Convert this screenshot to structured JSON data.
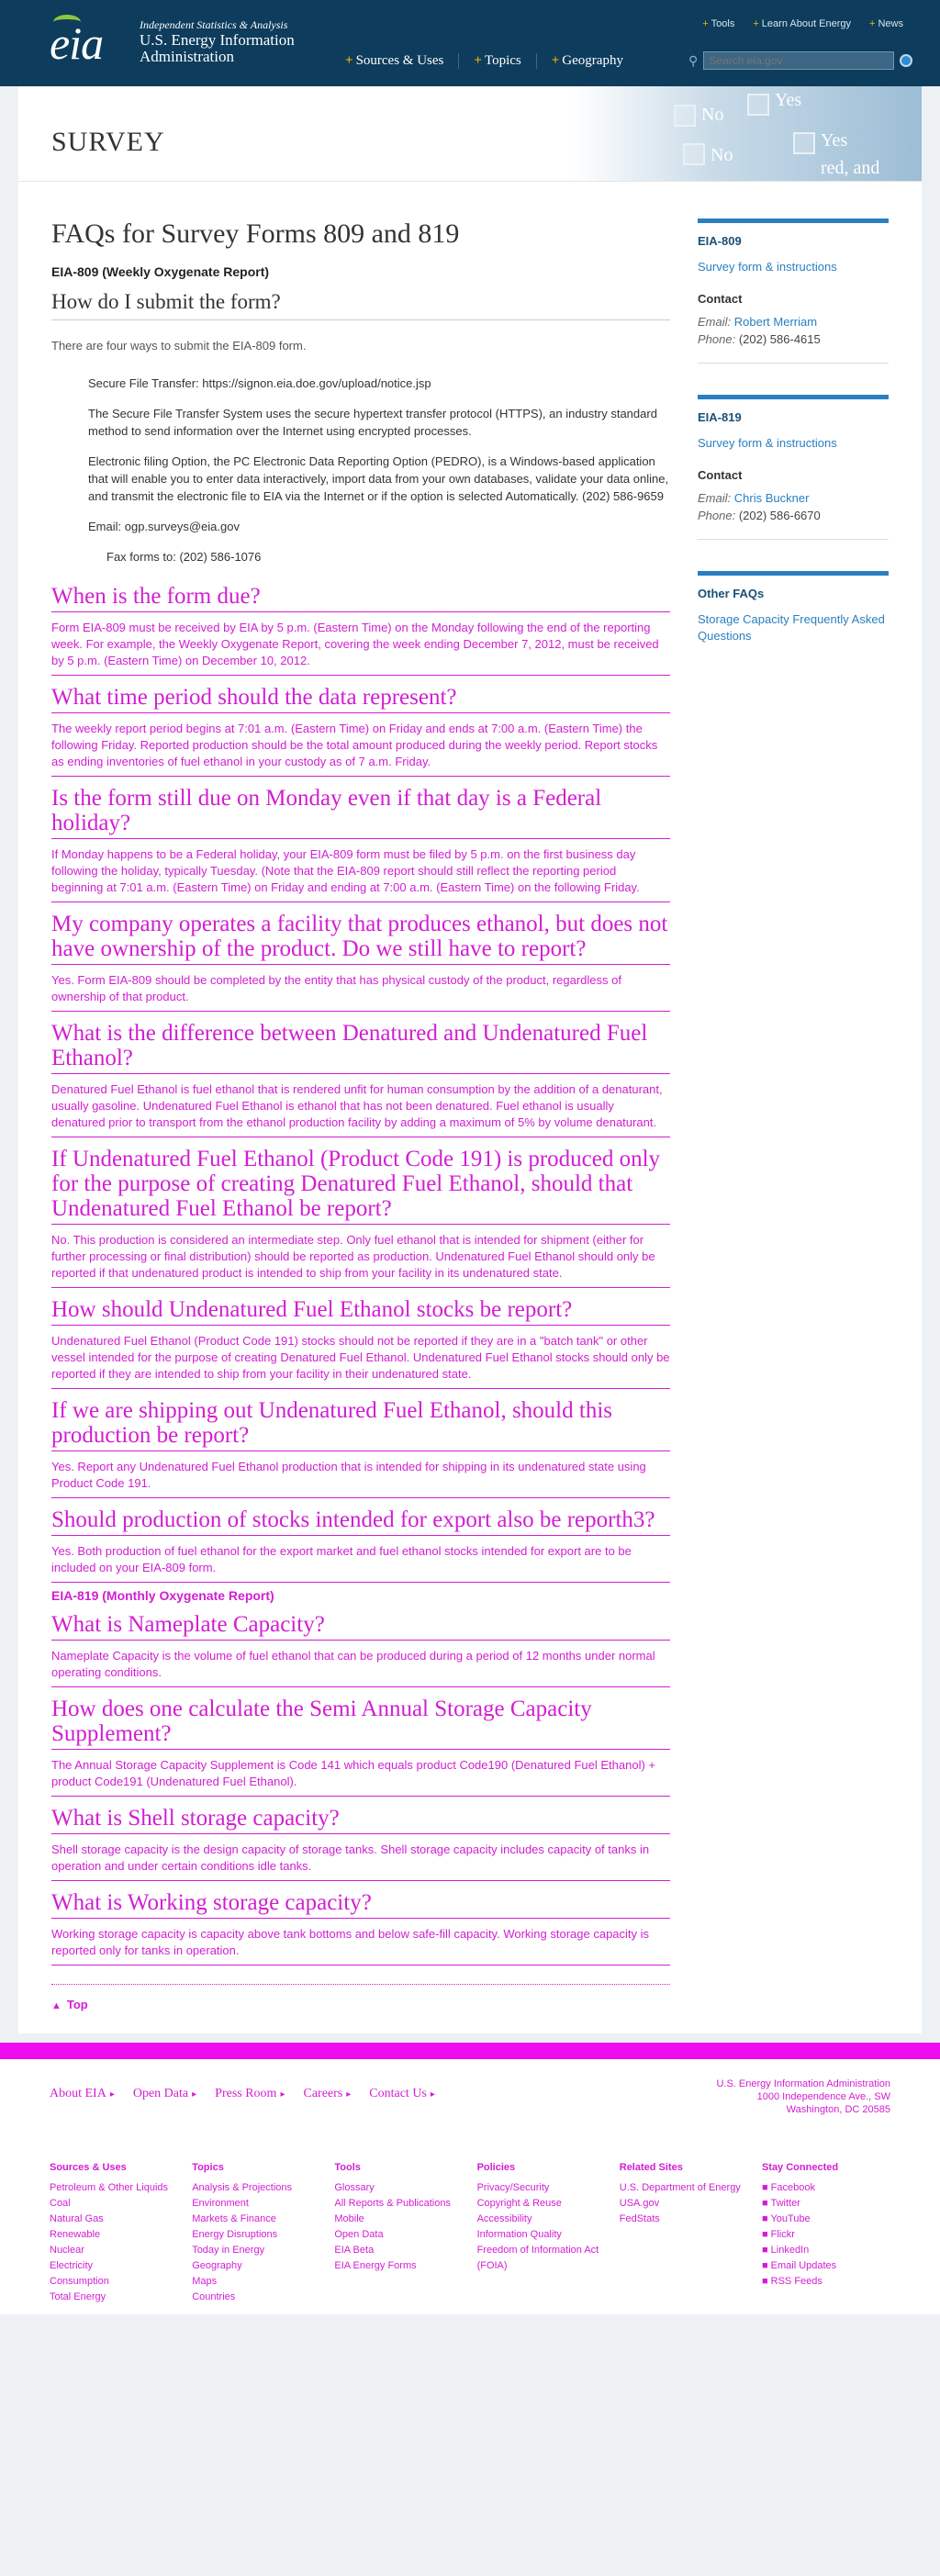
{
  "header": {
    "logo": "eia",
    "tagline": "Independent Statistics & Analysis",
    "org_line1": "U.S. Energy Information",
    "org_line2": "Administration",
    "top_links": [
      "Tools",
      "Learn About Energy",
      "News"
    ],
    "nav": [
      "Sources & Uses",
      "Topics",
      "Geography"
    ],
    "search_placeholder": "Search eia.gov"
  },
  "banner": {
    "title": "SURVEY",
    "art_words": [
      "No",
      "Yes",
      "No",
      "Yes",
      "red, and"
    ]
  },
  "main": {
    "title": "FAQs for Survey Forms 809 and 819",
    "survey_heading": "EIA-809 (Weekly Oxygenate Report)",
    "question1": "How do I submit the form?",
    "intro": "There are four ways to submit the EIA-809 form.",
    "methods": [
      "Secure File Transfer: https://signon.eia.doe.gov/upload/notice.jsp",
      "The Secure File Transfer System uses the secure hypertext transfer protocol (HTTPS), an industry standard method to send information over the Internet using encrypted processes.",
      "Electronic filing Option, the PC Electronic Data Reporting Option (PEDRO), is a Windows-based application that will enable you to enter data interactively, import data from your own databases, validate your data online, and transmit the electronic file to EIA via the Internet or if the option is selected Automatically. (202) 586-9659",
      "Email: ogp.surveys@eia.gov",
      "Fax forms to: (202) 586-1076"
    ],
    "qa": [
      {
        "q": "When is the form due?",
        "a": "Form EIA-809 must be received by EIA by 5 p.m. (Eastern Time) on the Monday following the end of the reporting week. For example, the Weekly Oxygenate Report, covering the week ending December 7, 2012, must be received by 5 p.m. (Eastern Time) on December 10, 2012."
      },
      {
        "q": "What time period should the data represent?",
        "a": "The weekly report period begins at 7:01 a.m. (Eastern Time) on Friday and ends at 7:00 a.m. (Eastern Time) the following Friday. Reported production should be the total amount produced during the weekly period. Report stocks as ending inventories of fuel ethanol in your custody as of 7 a.m. Friday."
      },
      {
        "q": "Is the form still due on Monday even if that day is a Federal holiday?",
        "a": "If Monday happens to be a Federal holiday, your EIA-809 form must be filed by 5 p.m. on the first business day following the holiday, typically Tuesday. (Note that the EIA-809 report should still reflect the reporting period beginning at 7:01 a.m. (Eastern Time) on Friday and ending at 7:00 a.m. (Eastern Time) on the following Friday."
      },
      {
        "q": "My company operates a facility that produces ethanol, but does not have ownership of the product. Do we still have to report?",
        "a": "Yes. Form EIA-809 should be completed by the entity that has physical custody of the product, regardless of ownership of that product."
      },
      {
        "q": "What is the difference between Denatured and Undenatured Fuel Ethanol?",
        "a": "Denatured Fuel Ethanol is fuel ethanol that is rendered unfit for human consumption by the addition of a denaturant, usually gasoline. Undenatured Fuel Ethanol is ethanol that has not been denatured. Fuel ethanol is usually denatured prior to transport from the ethanol production facility by adding a maximum of 5% by volume denaturant."
      },
      {
        "q": "If Undenatured Fuel Ethanol (Product Code 191) is produced only for the purpose of creating Denatured Fuel Ethanol, should that Undenatured Fuel Ethanol be report?",
        "a": "No. This production is considered an intermediate step. Only fuel ethanol that is intended for shipment (either for further processing or final distribution) should be reported as production. Undenatured Fuel Ethanol should only be reported if that undenatured product is intended to ship from your facility in its undenatured state."
      },
      {
        "q": "How should Undenatured Fuel Ethanol stocks be report?",
        "a": "Undenatured Fuel Ethanol (Product Code 191) stocks should not be reported if they are in a \"batch tank\" or other vessel intended for the purpose of creating Denatured Fuel Ethanol. Undenatured Fuel Ethanol stocks should only be reported if they are intended to ship from your facility in their undenatured state."
      },
      {
        "q": "If we are shipping out Undenatured Fuel Ethanol, should this production be report?",
        "a": "Yes. Report any Undenatured Fuel Ethanol production that is intended for shipping in its undenatured state using Product Code 191."
      },
      {
        "q": "Should production of stocks intended for export also be reporth3?",
        "a": "Yes. Both production of fuel ethanol for the export market and fuel ethanol stocks intended for export are to be included on your EIA-809 form."
      }
    ],
    "survey_heading2": "EIA-819 (Monthly Oxygenate Report)",
    "qa2": [
      {
        "q": "What is Nameplate Capacity?",
        "a": "Nameplate Capacity is the volume of fuel ethanol that can be produced during a period of 12 months under normal operating conditions."
      },
      {
        "q": "How does one calculate the Semi Annual Storage Capacity Supplement?",
        "a": "The Annual Storage Capacity Supplement is Code 141 which equals product Code190 (Denatured Fuel Ethanol) + product Code191 (Undenatured Fuel Ethanol)."
      },
      {
        "q": "What is Shell storage capacity?",
        "a": "Shell storage capacity is the design capacity of storage tanks. Shell storage capacity includes capacity of tanks in operation and under certain conditions idle tanks."
      },
      {
        "q": "What is Working storage capacity?",
        "a": "Working storage capacity is capacity above tank bottoms and below safe-fill capacity. Working storage capacity is reported only for tanks in operation."
      }
    ],
    "top_link": "Top"
  },
  "sidebar": {
    "box1": {
      "title": "EIA-809",
      "link": "Survey form & instructions",
      "contact_label": "Contact",
      "email_label": "Email:",
      "email_name": "Robert Merriam",
      "phone_label": "Phone:",
      "phone": "(202) 586-4615"
    },
    "box2": {
      "title": "EIA-819",
      "link": "Survey form & instructions",
      "contact_label": "Contact",
      "email_label": "Email:",
      "email_name": "Chris Buckner",
      "phone_label": "Phone:",
      "phone": "(202) 586-6670"
    },
    "box3": {
      "title": "Other FAQs",
      "link": "Storage Capacity Frequently Asked Questions"
    }
  },
  "footer": {
    "main_links": [
      "About EIA",
      "Open Data",
      "Press Room",
      "Careers",
      "Contact Us"
    ],
    "address": [
      "U.S. Energy Information Administration",
      "1000 Independence Ave., SW",
      "Washington, DC 20585"
    ],
    "columns": [
      {
        "h": "Sources & Uses",
        "l": [
          "Petroleum & Other Liquids",
          "Coal",
          "Natural Gas",
          "Renewable",
          "Nuclear",
          "Electricity",
          "Consumption",
          "Total Energy"
        ]
      },
      {
        "h": "Topics",
        "l": [
          "Analysis & Projections",
          "Environment",
          "Markets & Finance",
          "Energy Disruptions",
          "Today in Energy",
          "Geography",
          "Maps",
          "Countries"
        ]
      },
      {
        "h": "Tools",
        "l": [
          "Glossary",
          "All Reports & Publications",
          "Mobile",
          "Open Data",
          "EIA Beta",
          "EIA Energy Forms"
        ]
      },
      {
        "h": "Policies",
        "l": [
          "Privacy/Security",
          "Copyright & Reuse",
          "Accessibility",
          "Information Quality",
          "Freedom of Information Act (FOIA)"
        ]
      },
      {
        "h": "Related Sites",
        "l": [
          "U.S. Department of Energy",
          "USA.gov",
          "FedStats"
        ]
      },
      {
        "h": "Stay Connected",
        "l": [
          "Facebook",
          "Twitter",
          "YouTube",
          "Flickr",
          "LinkedIn",
          "Email Updates",
          "RSS Feeds"
        ]
      }
    ]
  }
}
